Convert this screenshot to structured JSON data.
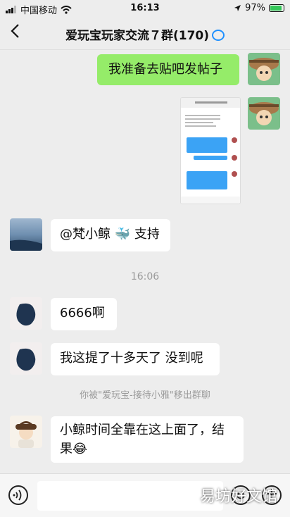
{
  "status_bar": {
    "carrier": "中国移动",
    "time": "16:13",
    "battery": "97%",
    "battery_level": 0.97
  },
  "header": {
    "back_icon": "chevron-left-icon",
    "title": "爱玩宝玩家交流７群(170)"
  },
  "messages": {
    "m1": {
      "text": "我准备去贴吧发帖子"
    },
    "m2": {
      "image_type": "screenshot-thumbnail"
    },
    "m3": {
      "text": "@梵小鲸",
      "emoji": "🐳",
      "tail": " 支持"
    },
    "time1": "16:06",
    "m4": {
      "text": "6666啊"
    },
    "m5": {
      "text": "我这提了十多天了 没到呢"
    },
    "notice": "你被\"爱玩宝-接待小雅\"移出群聊",
    "m6": {
      "text": "小鲸时间全靠在这上面了，结果",
      "emoji": "😂"
    }
  },
  "input_bar": {
    "voice_icon": "voice-icon",
    "emoji_icon": "emoji-icon",
    "plus_icon": "plus-icon"
  },
  "watermark": "易坊好文馆",
  "colors": {
    "background": "#ededed",
    "sent_bubble": "#95ec69",
    "received_bubble": "#ffffff",
    "battery_green": "#35c759"
  }
}
